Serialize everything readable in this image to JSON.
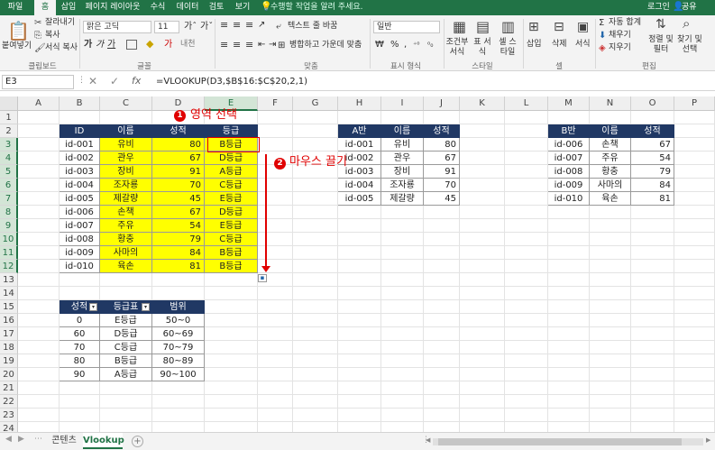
{
  "menu": {
    "tabs": [
      "파일",
      "홈",
      "삽입",
      "페이지 레이아웃",
      "수식",
      "데이터",
      "검토",
      "보기"
    ],
    "tell_me": "수행할 작업을 알려 주세요.",
    "login": "로그인",
    "share": "공유"
  },
  "ribbon": {
    "paste": "붙여넣기",
    "cut": "잘라내기",
    "copy": "복사",
    "format_painter": "서식 복사",
    "font_name": "맑은 고딕",
    "font_size": "11",
    "wrap_text": "텍스트 줄 바꿈",
    "merge_center": "병합하고 가운데 맞춤",
    "number_format": "일반",
    "cond_format": "조건부 서식",
    "table_format": "표 서식",
    "cell_style": "셀 스타일",
    "insert": "삽입",
    "delete": "삭제",
    "format": "서식",
    "autosum": "자동 합계",
    "fill": "채우기",
    "clear": "지우기",
    "sort_filter": "정렬 및 필터",
    "find_select": "찾기 및 선택",
    "groups": [
      "클립보드",
      "글꼴",
      "맞춤",
      "표시 형식",
      "스타일",
      "셀",
      "편집"
    ]
  },
  "formula_bar": {
    "name_box": "E3",
    "formula": "=VLOOKUP(D3,$B$16:$C$20,2,1)"
  },
  "columns": [
    "A",
    "B",
    "C",
    "D",
    "E",
    "F",
    "G",
    "H",
    "I",
    "J",
    "K",
    "L",
    "M",
    "N",
    "O",
    "P"
  ],
  "rows": [
    "1",
    "2",
    "3",
    "4",
    "5",
    "6",
    "7",
    "8",
    "9",
    "10",
    "11",
    "12",
    "13",
    "14",
    "15",
    "16",
    "17",
    "18",
    "19",
    "20",
    "21",
    "22",
    "23",
    "24"
  ],
  "annotations": {
    "step1": "영역 선택",
    "step2": "마우스 끌기",
    "step1_num": "1",
    "step2_num": "2"
  },
  "main_table": {
    "headers": [
      "ID",
      "이름",
      "성적",
      "등급"
    ],
    "rows": [
      [
        "id-001",
        "유비",
        "80",
        "B등급"
      ],
      [
        "id-002",
        "관우",
        "67",
        "D등급"
      ],
      [
        "id-003",
        "장비",
        "91",
        "A등급"
      ],
      [
        "id-004",
        "조자룡",
        "70",
        "C등급"
      ],
      [
        "id-005",
        "제갈량",
        "45",
        "E등급"
      ],
      [
        "id-006",
        "손책",
        "67",
        "D등급"
      ],
      [
        "id-007",
        "주유",
        "54",
        "E등급"
      ],
      [
        "id-008",
        "황충",
        "79",
        "C등급"
      ],
      [
        "id-009",
        "사마의",
        "84",
        "B등급"
      ],
      [
        "id-010",
        "육손",
        "81",
        "B등급"
      ]
    ]
  },
  "table_a": {
    "headers": [
      "A반",
      "이름",
      "성적"
    ],
    "rows": [
      [
        "id-001",
        "유비",
        "80"
      ],
      [
        "id-002",
        "관우",
        "67"
      ],
      [
        "id-003",
        "장비",
        "91"
      ],
      [
        "id-004",
        "조자룡",
        "70"
      ],
      [
        "id-005",
        "제갈량",
        "45"
      ]
    ]
  },
  "table_b": {
    "headers": [
      "B반",
      "이름",
      "성적"
    ],
    "rows": [
      [
        "id-006",
        "손책",
        "67"
      ],
      [
        "id-007",
        "주유",
        "54"
      ],
      [
        "id-008",
        "황충",
        "79"
      ],
      [
        "id-009",
        "사마의",
        "84"
      ],
      [
        "id-010",
        "육손",
        "81"
      ]
    ]
  },
  "grade_table": {
    "headers": [
      "성적",
      "등급표",
      "범위"
    ],
    "rows": [
      [
        "0",
        "E등급",
        "50~0"
      ],
      [
        "60",
        "D등급",
        "60~69"
      ],
      [
        "70",
        "C등급",
        "70~79"
      ],
      [
        "80",
        "B등급",
        "80~89"
      ],
      [
        "90",
        "A등급",
        "90~100"
      ]
    ]
  },
  "sheets": [
    "콘텐츠",
    "Vlookup"
  ],
  "colors": {
    "excel_green": "#217346",
    "header_navy": "#203864",
    "highlight_yellow": "#ffff00",
    "annotation_red": "#e00000"
  }
}
